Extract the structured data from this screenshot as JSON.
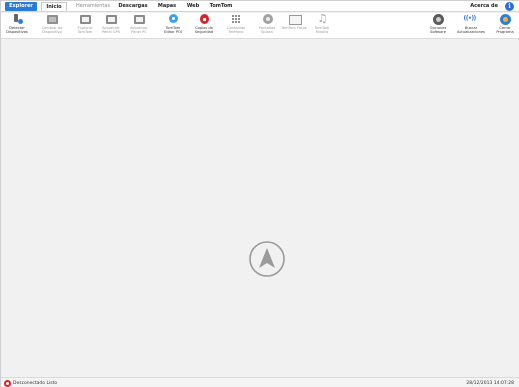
{
  "menu": {
    "explorer": "Explorer",
    "inicio": "Inicio",
    "herramientas": "Herramientas",
    "descargas": "Descargas",
    "mapas": "Mapas",
    "web": "Web",
    "tomtom": "TomTom",
    "about": "Acerca de"
  },
  "toolbar": {
    "detect": "Detectar Dispositivos",
    "change": "Cambiar de Dispositivo",
    "explore": "Explorar TomTom",
    "gps_panel": "Actualizar Panel GPS",
    "pc_panel": "Actualizar Panel PC",
    "poi_editor": "TomTom Editor POI",
    "backup": "Copias de Seguridad",
    "contacts": "Contactos Teléfono",
    "splash": "Pantallas Splash",
    "photo": "TomTom Fotos",
    "music": "TomTom Música",
    "options": "Opciones Software",
    "updates": "Buscar Actualizaciones",
    "close": "Cerrar Programa"
  },
  "status": {
    "state": "Desconectado  Listo",
    "datetime": "28/12/2013  14:07:28"
  },
  "colors": {
    "accent": "#2b7ad7",
    "disconnected": "#d8232a"
  }
}
